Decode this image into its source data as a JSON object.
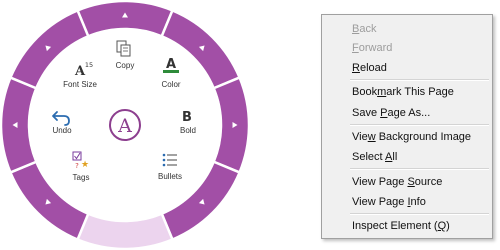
{
  "radial_menu": {
    "center_glyph": "A",
    "commands": [
      {
        "name": "copy",
        "label": "Copy"
      },
      {
        "name": "color",
        "label": "Color",
        "glyph": "A"
      },
      {
        "name": "bold",
        "label": "Bold",
        "glyph": "B"
      },
      {
        "name": "bullets",
        "label": "Bullets"
      },
      {
        "name": "tags",
        "label": "Tags"
      },
      {
        "name": "undo",
        "label": "Undo"
      },
      {
        "name": "font-size",
        "label": "Font Size",
        "glyph": "A",
        "sup": "15"
      }
    ]
  },
  "context_menu": {
    "items": [
      {
        "pre": "",
        "ul": "B",
        "post": "ack",
        "disabled": true
      },
      {
        "pre": "",
        "ul": "F",
        "post": "orward",
        "disabled": true
      },
      {
        "pre": "",
        "ul": "R",
        "post": "eload",
        "disabled": false
      },
      {
        "pre": "Book",
        "ul": "m",
        "post": "ark This Page",
        "disabled": false
      },
      {
        "pre": "Save ",
        "ul": "P",
        "post": "age As...",
        "disabled": false
      },
      {
        "pre": "Vie",
        "ul": "w",
        "post": " Background Image",
        "disabled": false
      },
      {
        "pre": "Select ",
        "ul": "A",
        "post": "ll",
        "disabled": false
      },
      {
        "pre": "View Page ",
        "ul": "S",
        "post": "ource",
        "disabled": false
      },
      {
        "pre": "View Page ",
        "ul": "I",
        "post": "nfo",
        "disabled": false
      },
      {
        "pre": "Inspect Element (",
        "ul": "Q",
        "post": ")",
        "disabled": false
      }
    ]
  },
  "colors": {
    "ring": "#a24fa6",
    "ring_active": "#ecd4ee",
    "accent_purple": "#8d3f8f",
    "underline_green": "#2e8b3a",
    "undo_blue": "#2b6cb0",
    "menu_bg": "#f0f0f0"
  }
}
